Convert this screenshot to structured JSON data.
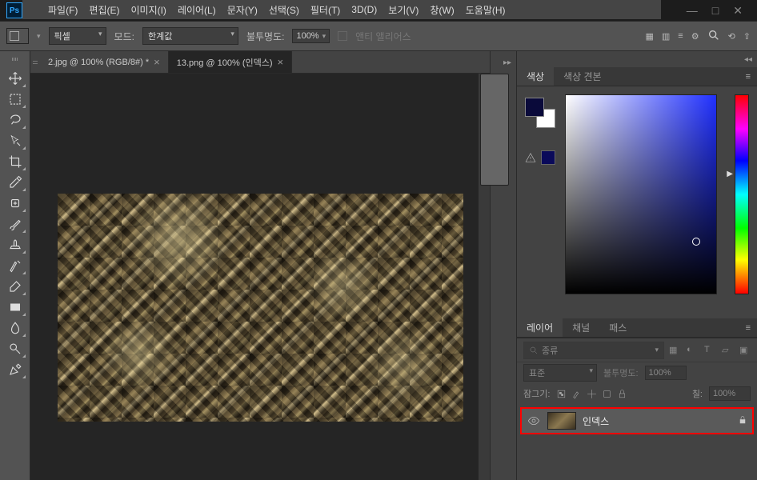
{
  "app": {
    "logo": "Ps"
  },
  "menu": {
    "file": "파일(F)",
    "edit": "편집(E)",
    "image": "이미지(I)",
    "layer": "레이어(L)",
    "type": "문자(Y)",
    "select": "선택(S)",
    "filter": "필터(T)",
    "threeD": "3D(D)",
    "view": "보기(V)",
    "window": "창(W)",
    "help": "도움말(H)"
  },
  "options": {
    "unit": "픽셀",
    "mode_label": "모드:",
    "mode_value": "한계값",
    "opacity_label": "불투명도:",
    "opacity_value": "100%",
    "antialias": "앤티 앨리어스"
  },
  "tabs": [
    {
      "label": "2.jpg @ 100% (RGB/8#) *",
      "active": false
    },
    {
      "label": "13.png @ 100% (인덱스)",
      "active": true
    }
  ],
  "color_panel": {
    "tab1": "색상",
    "tab2": "색상 견본"
  },
  "layers_panel": {
    "tab1": "레이어",
    "tab2": "채널",
    "tab3": "패스",
    "kind_label": "종류",
    "blend_mode": "표준",
    "opacity_label": "불투명도:",
    "opacity_value": "100%",
    "lock_label": "잠그기:",
    "fill_label": "칠:",
    "fill_value": "100%",
    "layers": [
      {
        "name": "인덱스",
        "locked": true
      }
    ]
  }
}
